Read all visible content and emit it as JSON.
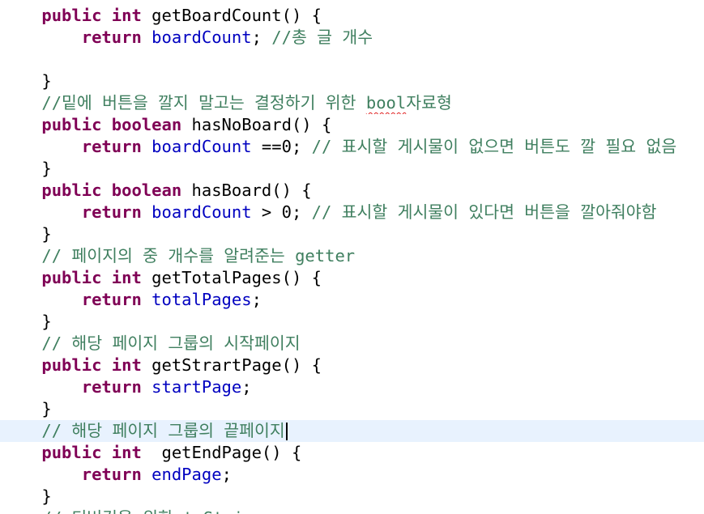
{
  "editor": {
    "lines": [
      {
        "indent": "    ",
        "parts": [
          {
            "t": "public",
            "c": "kw"
          },
          {
            "t": " "
          },
          {
            "t": "int",
            "c": "kw"
          },
          {
            "t": " getBoardCount() {"
          }
        ]
      },
      {
        "indent": "        ",
        "parts": [
          {
            "t": "return",
            "c": "kw"
          },
          {
            "t": " "
          },
          {
            "t": "boardCount",
            "c": "fld"
          },
          {
            "t": "; "
          },
          {
            "t": "//총 글 개수",
            "c": "cm"
          }
        ]
      },
      {
        "indent": "",
        "parts": []
      },
      {
        "indent": "    ",
        "parts": [
          {
            "t": "}"
          }
        ]
      },
      {
        "indent": "    ",
        "parts": [
          {
            "t": "//밑에 버튼을 깔지 말고는 결정하기 위한 ",
            "c": "cm"
          },
          {
            "t": "bool",
            "c": "cm squiggle"
          },
          {
            "t": "자료형",
            "c": "cm"
          }
        ]
      },
      {
        "indent": "    ",
        "parts": [
          {
            "t": "public",
            "c": "kw"
          },
          {
            "t": " "
          },
          {
            "t": "boolean",
            "c": "kw"
          },
          {
            "t": " hasNoBoard() {"
          }
        ]
      },
      {
        "indent": "        ",
        "parts": [
          {
            "t": "return",
            "c": "kw"
          },
          {
            "t": " "
          },
          {
            "t": "boardCount",
            "c": "fld"
          },
          {
            "t": " ==0; "
          },
          {
            "t": "// 표시할 게시물이 없으면 버튼도 깔 필요 없음",
            "c": "cm"
          }
        ]
      },
      {
        "indent": "    ",
        "parts": [
          {
            "t": "}"
          }
        ]
      },
      {
        "indent": "    ",
        "parts": [
          {
            "t": "public",
            "c": "kw"
          },
          {
            "t": " "
          },
          {
            "t": "boolean",
            "c": "kw"
          },
          {
            "t": " hasBoard() {"
          }
        ]
      },
      {
        "indent": "        ",
        "parts": [
          {
            "t": "return",
            "c": "kw"
          },
          {
            "t": " "
          },
          {
            "t": "boardCount",
            "c": "fld"
          },
          {
            "t": " > 0; "
          },
          {
            "t": "// 표시할 게시물이 있다면 버튼을 깔아줘야함",
            "c": "cm"
          }
        ]
      },
      {
        "indent": "    ",
        "parts": [
          {
            "t": "}"
          }
        ]
      },
      {
        "indent": "    ",
        "parts": [
          {
            "t": "// 페이지의 중 개수를 알려준는 getter",
            "c": "cm"
          }
        ]
      },
      {
        "indent": "    ",
        "parts": [
          {
            "t": "public",
            "c": "kw"
          },
          {
            "t": " "
          },
          {
            "t": "int",
            "c": "kw"
          },
          {
            "t": " getTotalPages() {"
          }
        ]
      },
      {
        "indent": "        ",
        "parts": [
          {
            "t": "return",
            "c": "kw"
          },
          {
            "t": " "
          },
          {
            "t": "totalPages",
            "c": "fld"
          },
          {
            "t": ";"
          }
        ]
      },
      {
        "indent": "    ",
        "parts": [
          {
            "t": "}"
          }
        ]
      },
      {
        "indent": "    ",
        "parts": [
          {
            "t": "// 해당 페이지 그룹의 시작페이지",
            "c": "cm"
          }
        ]
      },
      {
        "indent": "    ",
        "parts": [
          {
            "t": "public",
            "c": "kw"
          },
          {
            "t": " "
          },
          {
            "t": "int",
            "c": "kw"
          },
          {
            "t": " getStrartPage() {"
          }
        ]
      },
      {
        "indent": "        ",
        "parts": [
          {
            "t": "return",
            "c": "kw"
          },
          {
            "t": " "
          },
          {
            "t": "startPage",
            "c": "fld"
          },
          {
            "t": ";"
          }
        ]
      },
      {
        "indent": "    ",
        "parts": [
          {
            "t": "}"
          }
        ]
      },
      {
        "indent": "    ",
        "current": true,
        "caret": true,
        "parts": [
          {
            "t": "// 해당 페이지 그룹의 끝페이지",
            "c": "cm"
          }
        ]
      },
      {
        "indent": "    ",
        "parts": [
          {
            "t": "public",
            "c": "kw"
          },
          {
            "t": " "
          },
          {
            "t": "int",
            "c": "kw"
          },
          {
            "t": "  getEndPage() {"
          }
        ]
      },
      {
        "indent": "        ",
        "parts": [
          {
            "t": "return",
            "c": "kw"
          },
          {
            "t": " "
          },
          {
            "t": "endPage",
            "c": "fld"
          },
          {
            "t": ";"
          }
        ]
      },
      {
        "indent": "    ",
        "parts": [
          {
            "t": "}"
          }
        ]
      },
      {
        "indent": "    ",
        "cut": true,
        "parts": [
          {
            "t": "// 디버깅을 위한 toString",
            "c": "cm"
          }
        ]
      }
    ]
  }
}
